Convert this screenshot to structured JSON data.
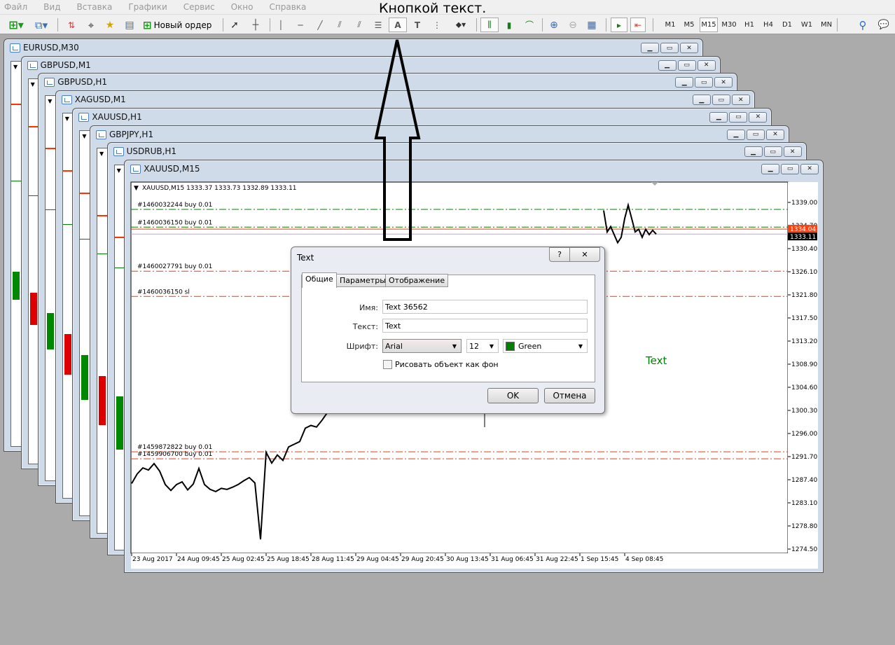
{
  "menu": [
    "Файл",
    "Вид",
    "Вставка",
    "Графики",
    "Сервис",
    "Окно",
    "Справка"
  ],
  "caption": "Кнопкой текст.",
  "toolbar": {
    "new_order": "Новый ордер",
    "timeframes": [
      "M1",
      "M5",
      "M15",
      "M30",
      "H1",
      "H4",
      "D1",
      "W1",
      "MN"
    ],
    "active_timeframe": "M15",
    "icons": [
      "new-chart-icon",
      "profiles-icon",
      "market-watch-icon",
      "navigator-crosshair-icon",
      "favorites-icon",
      "terminal-icon",
      "new-order-icon",
      "cursor-icon",
      "crosshair-icon",
      "vertical-line-icon",
      "horizontal-line-icon",
      "trendline-icon",
      "equidistant-channel-icon",
      "std-deviation-channel-icon",
      "fibonacci-icon",
      "text-icon",
      "text-label-icon",
      "fibo-fan-icon",
      "arrows-icon",
      "bar-chart-icon",
      "candlestick-icon",
      "line-chart-icon",
      "zoom-in-icon",
      "zoom-out-icon",
      "tile-windows-icon",
      "autoscroll-icon",
      "chart-shift-icon",
      "search-icon",
      "chat-icon"
    ]
  },
  "windows": [
    "EURUSD,M30",
    "GBPUSD,M1",
    "GBPUSD,H1",
    "XAGUSD,M1",
    "XAUUSD,H1",
    "GBPJPY,H1",
    "USDRUB,H1",
    "XAUUSD,M15"
  ],
  "chart": {
    "header": "XAUUSD,M15  1333.37 1333.73 1332.89 1333.11",
    "price_ticks": [
      "1339.00",
      "1334.70",
      "1330.40",
      "1326.10",
      "1321.80",
      "1317.50",
      "1313.20",
      "1308.90",
      "1304.60",
      "1300.30",
      "1296.00",
      "1291.70",
      "1287.40",
      "1283.10",
      "1278.80",
      "1274.50"
    ],
    "ylim": [
      1274.5,
      1339.0
    ],
    "time_labels": [
      "23 Aug 2017",
      "24 Aug 09:45",
      "25 Aug 02:45",
      "25 Aug 18:45",
      "28 Aug 11:45",
      "29 Aug 04:45",
      "29 Aug 20:45",
      "30 Aug 13:45",
      "31 Aug 06:45",
      "31 Aug 22:45",
      "1 Sep 15:45",
      "4 Sep 08:45"
    ],
    "ask_label": "1334.04",
    "bid_label": "1333.11",
    "ask_price": 1334.04,
    "bid_price": 1333.11,
    "order_lines": [
      {
        "label": "#1460032244 buy 0.01",
        "price": 1337.7,
        "color": "#008000"
      },
      {
        "label": "#1460036150 buy 0.01",
        "price": 1334.4,
        "color": "#008000"
      },
      {
        "label": "#1460027791 buy 0.01",
        "price": 1326.2,
        "color": "#ff3300"
      },
      {
        "label": "#1460036150 sl",
        "price": 1321.5,
        "color": "#ff3300"
      },
      {
        "label": "#1459872822 buy 0.01",
        "price": 1292.6,
        "color": "#ff3300"
      },
      {
        "label": "#1459906700 buy 0.01",
        "price": 1291.3,
        "color": "#ff3300"
      }
    ],
    "price_segment_1": [
      1286.7,
      1288.5,
      1289.6,
      1289.2,
      1290.4,
      1289.0,
      1286.5,
      1285.4,
      1286.5,
      1287.0,
      1285.5,
      1286.6,
      1289.5,
      1286.5,
      1285.6,
      1285.2,
      1285.8,
      1285.6,
      1286.0,
      1286.5,
      1287.2,
      1287.8,
      1286.8,
      1276.3,
      1292.5,
      1290.5,
      1292.0,
      1291.0,
      1293.5,
      1294.0,
      1294.5,
      1297.0,
      1297.5,
      1297.2,
      1298.5,
      1300.0
    ],
    "price_segment_2": [
      1337.5,
      1333.5,
      1334.5,
      1333.0,
      1331.5,
      1332.5,
      1336.0,
      1338.5,
      1336.0,
      1333.5,
      1334.0,
      1332.5,
      1334.0,
      1333.0,
      1333.8,
      1333.1
    ],
    "text_object": "Text",
    "text_color": "#008000"
  },
  "dialog": {
    "title": "Text",
    "help": "?",
    "close": "✕",
    "tabs": [
      "Общие",
      "Параметры",
      "Отображение"
    ],
    "name_label": "Имя:",
    "name_value": "Text 36562",
    "text_label": "Текст:",
    "text_value": "Text",
    "font_label": "Шрифт:",
    "font_value": "Arial",
    "size_value": "12",
    "color_value": "Green",
    "color_swatch": "#008000",
    "background_checkbox": "Рисовать объект как фон",
    "background_checked": false,
    "ok": "OK",
    "cancel": "Отмена"
  }
}
